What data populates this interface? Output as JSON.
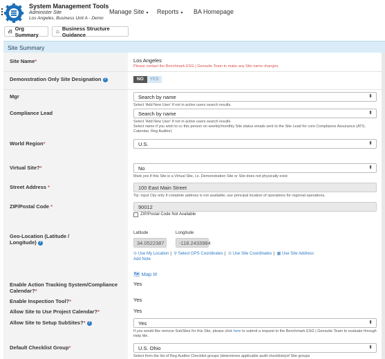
{
  "header": {
    "app_title": "System Management Tools",
    "subtitle": "Administer Site",
    "location": "Los Angeles, Business Unit A - Demo",
    "nav": [
      {
        "label": "Manage Site",
        "caret": "▾"
      },
      {
        "label": "Reports",
        "caret": "▾"
      },
      {
        "label": "BA Homepage",
        "caret": ""
      }
    ]
  },
  "toolbar": {
    "org_summary": "Org Summary",
    "business_structure": "Business Structure Guidance"
  },
  "section_title": "Site Summary",
  "fields": {
    "site_name": {
      "label": "Site Name",
      "value": "Los Angeles",
      "note": "Please contact the Benchmark ESG | Gensuite Team to make any Site name changes."
    },
    "demo_site": {
      "label": "Demonstration Only Site Designation",
      "toggle_no": "NO",
      "toggle_yes": "YES"
    },
    "mgr": {
      "label": "Mgr",
      "value": "Search by name",
      "hint": "Select 'Add New User' if not in active users search results."
    },
    "compliance_lead": {
      "label": "Compliance Lead",
      "value": "Search by name",
      "hint1": "Select 'Add New User' if not in active users search results.",
      "hint2": "Select name if you wish to cc this person on weekly/monthly Site status emails sent to the Site Lead for core Compliance Assurance (ATS, Calendar, Reg Auditor)"
    },
    "world_region": {
      "label": "World Region",
      "value": "U.S."
    },
    "virtual_site": {
      "label": "Virtual Site?",
      "value": "No",
      "hint": "Mark yes if this Site is a Virtual Site, i.e. Demonstration Site or Site does not physically exist"
    },
    "street": {
      "label": "Street Address",
      "value": "100 East Main Street",
      "hint": "Tip: input City only if complete address is not available; use principal location of operations for regional operations."
    },
    "zip": {
      "label": "ZIP/Postal Code",
      "value": "90012",
      "checkbox_label": "ZIP/Postal Code Not Available"
    },
    "geo": {
      "label": "Geo-Location (Latitude / Longitude)",
      "lat_label": "Latitude",
      "lng_label": "Longitude",
      "lat": "34.0522387",
      "lng": "-118.2433984",
      "link_my_location": "Use My Location",
      "link_gps": "Select GPS Coordinates",
      "link_site_coords": "Use Site Coordinates",
      "link_site_address": "Use Site Address",
      "add_note": "Add Note",
      "map_it": "Map It!"
    },
    "action_tracking": {
      "label": "Enable Action Tracking System/Compliance Calendar?",
      "value": "Yes"
    },
    "inspection": {
      "label": "Enable Inspection Tool?",
      "value": "Yes"
    },
    "project_calendar": {
      "label": "Allow Site to Use Project Calendar?",
      "value": "Yes"
    },
    "subsites": {
      "label": "Allow Site to Setup SubSites?",
      "value": "Yes",
      "hint_pre": "If you would like remove SubSites for this Site, please click",
      "hint_link": "here",
      "hint_post": "to submit a request to the Benchmark ESG | Gensuite Team to evaluate through Help Me."
    },
    "checklist": {
      "label": "Default Checklist Group",
      "value": "U.S. Ohio",
      "hint": "Select from the list of Reg Auditor Checklist groups (determines applicable audit checklists)of Site groups"
    }
  },
  "colors": {
    "section_bg": "#d9ecf7",
    "required": "#d9534f",
    "link": "#2a78c5"
  }
}
